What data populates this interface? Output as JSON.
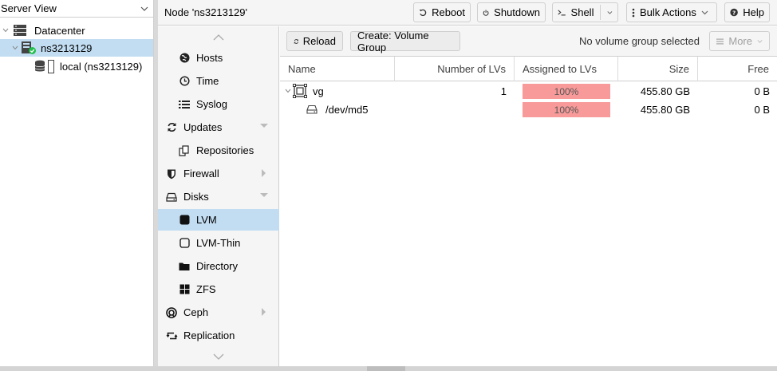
{
  "tree": {
    "view_label": "Server View",
    "datacenter": "Datacenter",
    "node": "ns3213129",
    "storage": "local (ns3213129)"
  },
  "header": {
    "title": "Node 'ns3213129'",
    "reboot": "Reboot",
    "shutdown": "Shutdown",
    "shell": "Shell",
    "bulk_actions": "Bulk Actions",
    "help": "Help"
  },
  "nav": {
    "items": [
      {
        "label": "Hosts",
        "icon": "globe-icon"
      },
      {
        "label": "Time",
        "icon": "clock-icon"
      },
      {
        "label": "Syslog",
        "icon": "list-icon"
      },
      {
        "label": "Updates",
        "icon": "refresh-icon"
      },
      {
        "label": "Repositories",
        "icon": "copy-icon"
      },
      {
        "label": "Firewall",
        "icon": "shield-icon"
      },
      {
        "label": "Disks",
        "icon": "hdd-icon"
      },
      {
        "label": "LVM",
        "icon": "square-icon"
      },
      {
        "label": "LVM-Thin",
        "icon": "square-outline-icon"
      },
      {
        "label": "Directory",
        "icon": "folder-icon"
      },
      {
        "label": "ZFS",
        "icon": "th-large-icon"
      },
      {
        "label": "Ceph",
        "icon": "ceph-icon"
      },
      {
        "label": "Replication",
        "icon": "retweet-icon"
      }
    ]
  },
  "toolbar": {
    "reload": "Reload",
    "create": "Create: Volume Group",
    "status": "No volume group selected",
    "more": "More"
  },
  "grid": {
    "columns": [
      "Name",
      "Number of LVs",
      "Assigned to LVs",
      "Size",
      "Free"
    ],
    "rows": [
      {
        "name": "vg",
        "lvs": "1",
        "assigned": "100%",
        "assigned_fraction": 1.0,
        "size": "455.80 GB",
        "free": "0 B"
      },
      {
        "name": "/dev/md5",
        "lvs": "",
        "assigned": "100%",
        "assigned_fraction": 1.0,
        "size": "455.80 GB",
        "free": "0 B"
      }
    ]
  },
  "colors": {
    "selection": "#c2ddf2",
    "usage_bar": "#f89a9a",
    "status_ok": "#21bf4b"
  }
}
